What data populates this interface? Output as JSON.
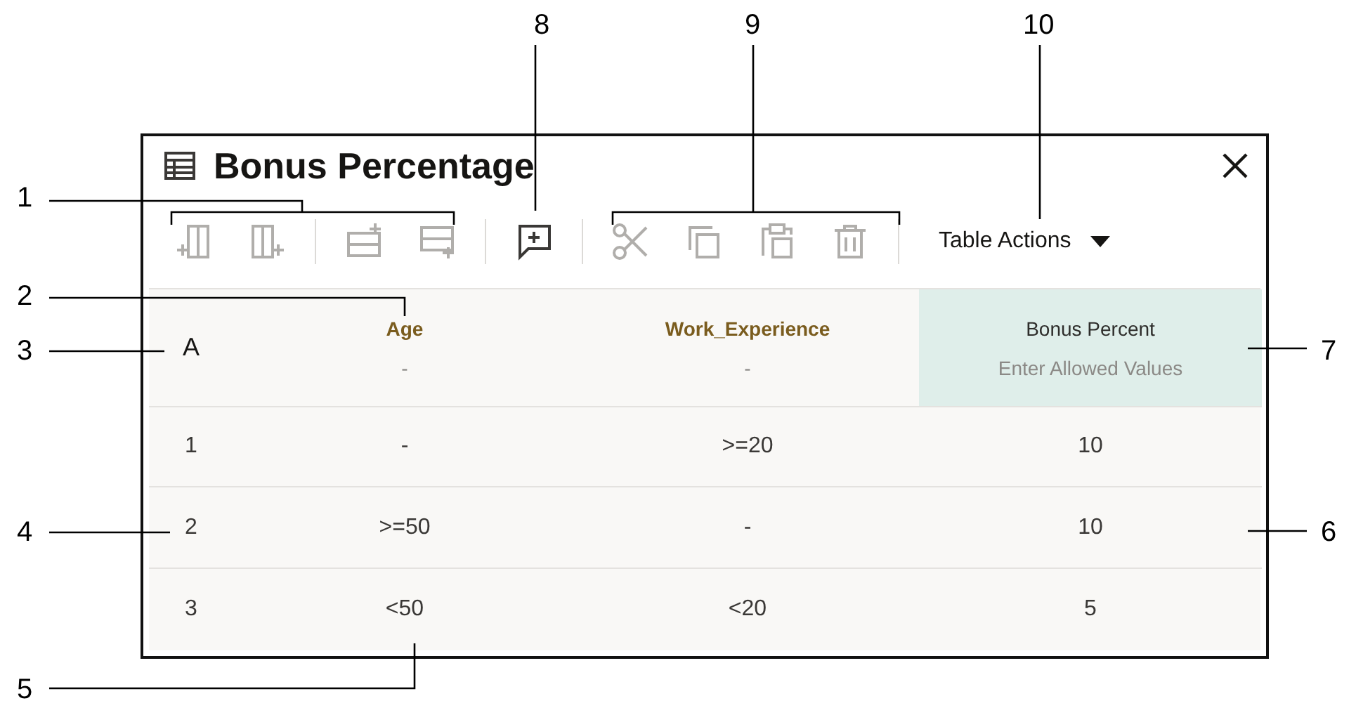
{
  "panel": {
    "title": "Bonus Percentage"
  },
  "toolbar": [
    {
      "buttons": [
        {
          "kind": "col-before",
          "disabled": true
        },
        {
          "kind": "col-after",
          "disabled": true
        }
      ]
    },
    {
      "buttons": [
        {
          "kind": "row-before",
          "disabled": true
        },
        {
          "kind": "row-after",
          "disabled": true
        }
      ]
    },
    {
      "buttons": [
        {
          "kind": "comment",
          "disabled": false
        }
      ]
    },
    {
      "buttons": [
        {
          "kind": "cut",
          "disabled": true
        },
        {
          "kind": "copy",
          "disabled": true
        },
        {
          "kind": "paste",
          "disabled": true
        },
        {
          "kind": "delete",
          "disabled": true
        }
      ]
    }
  ],
  "table_actions": {
    "label": "Table Actions"
  },
  "table": {
    "corner": "A",
    "columns": [
      {
        "label": "Age",
        "kind": "input",
        "hint": "-"
      },
      {
        "label": "Work_Experience",
        "kind": "input",
        "hint": "-"
      },
      {
        "label": "Bonus Percent",
        "kind": "output",
        "hint": "Enter Allowed Values"
      }
    ],
    "rows": [
      {
        "number": "1",
        "cells": [
          "-",
          ">=20",
          "10"
        ]
      },
      {
        "number": "2",
        "cells": [
          ">=50",
          "-",
          "10"
        ]
      },
      {
        "number": "3",
        "cells": [
          "<50",
          "<20",
          "5"
        ]
      }
    ]
  },
  "callouts": [
    "1",
    "2",
    "3",
    "4",
    "5",
    "6",
    "7",
    "8",
    "9",
    "10"
  ]
}
